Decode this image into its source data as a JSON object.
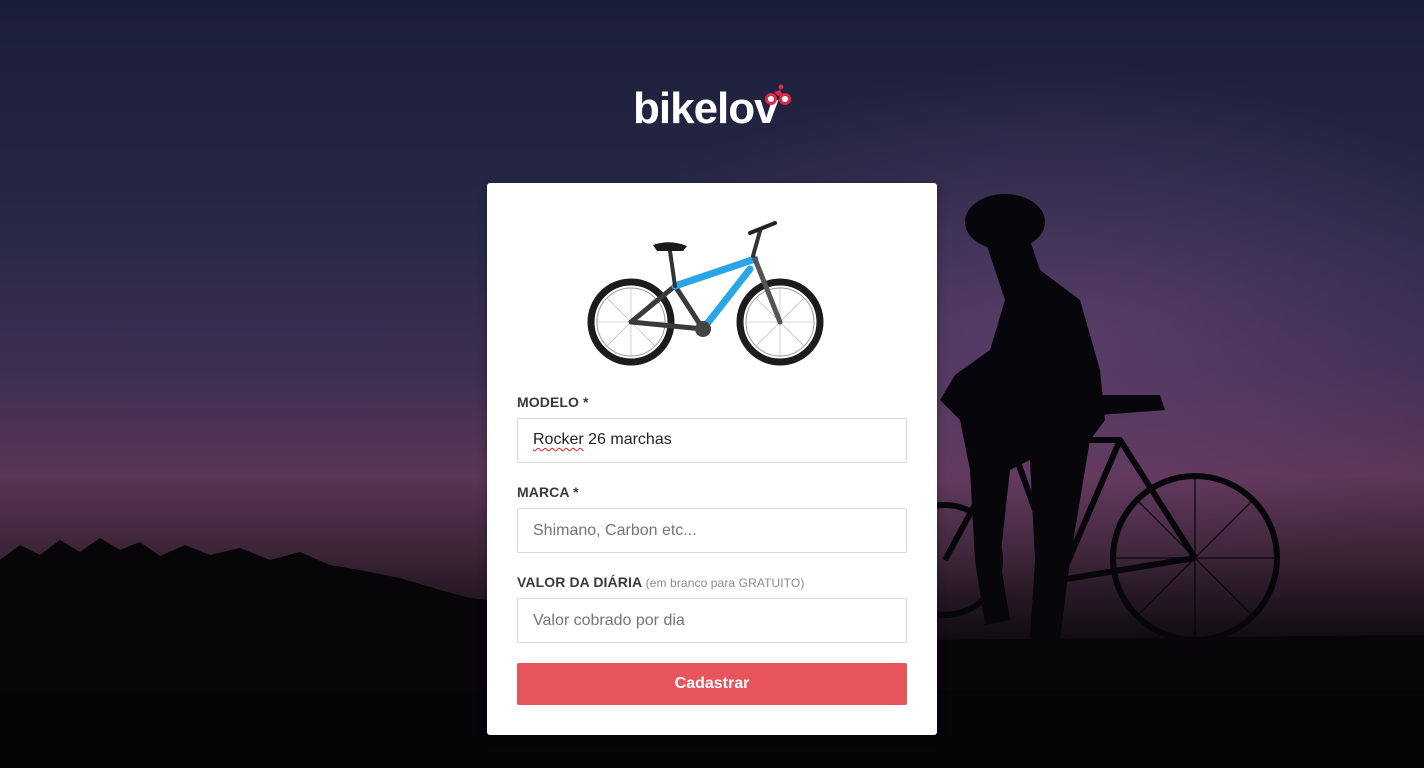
{
  "brand": {
    "name": "bikelov",
    "accent_color": "#e8545b",
    "logo_mark_icon": "cyclist-icon"
  },
  "form": {
    "image_icon": "mountain-bike-image",
    "modelo": {
      "label": "MODELO *",
      "value": "Rocker 26 marchas",
      "value_first_word": "Rocker",
      "value_rest": " 26 marchas"
    },
    "marca": {
      "label": "MARCA *",
      "placeholder": "Shimano, Carbon etc..."
    },
    "valor": {
      "label": "VALOR DA DIÁRIA",
      "hint": "(em branco para GRATUITO)",
      "placeholder": "Valor cobrado por dia"
    },
    "submit_label": "Cadastrar"
  }
}
